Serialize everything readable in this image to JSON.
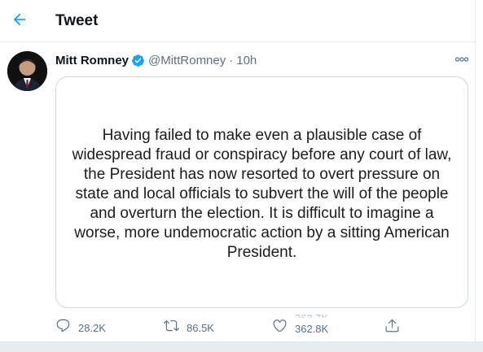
{
  "header": {
    "title": "Tweet",
    "back_icon": "arrow-left-icon"
  },
  "tweet": {
    "author": {
      "display_name": "Mitt Romney",
      "handle": "@MittRomney",
      "verified_icon": "verified-badge-icon"
    },
    "separator": "·",
    "time": "10h",
    "more_icon": "more-horizontal-icon",
    "image_text": "Having failed to make even a plausible case of widespread fraud or conspiracy before any court of law, the President has now resorted to overt pressure on state and local officials to subvert the will of the people and overturn the election. It is difficult to imagine a worse, more undemocratic action by a sitting American President."
  },
  "actions": {
    "reply": {
      "icon": "reply-icon",
      "count": "28.2K"
    },
    "retweet": {
      "icon": "retweet-icon",
      "count": "86.5K"
    },
    "like": {
      "icon": "heart-icon",
      "count": "362.8K",
      "ghost_count": "362.7K"
    },
    "share": {
      "icon": "share-icon"
    }
  },
  "colors": {
    "accent": "#1da1f2",
    "secondary_text": "#5b7083",
    "border": "#ccd6dd"
  }
}
